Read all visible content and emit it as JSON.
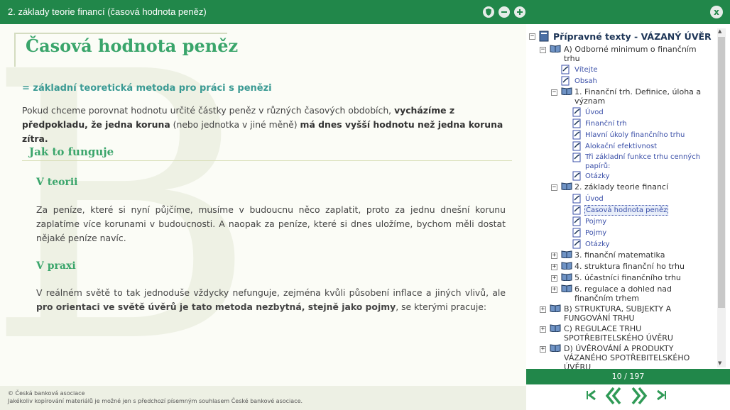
{
  "window": {
    "title": "2. základy teorie financí (časová hodnota peněz)",
    "buttons": [
      "shield-icon",
      "minus-icon",
      "plus-icon"
    ],
    "close_label": "x"
  },
  "content": {
    "watermark": "B",
    "title": "Časová hodnota peněz",
    "subtitle": "= základní teoretická metoda pro práci s penězi",
    "intro_part1": "Pokud chceme porovnat hodnotu určité částky peněz v různých časových obdobích, ",
    "intro_bold1": "vycházíme z předpokladu, že jedna koruna",
    "intro_part2": " (nebo jednotka v jiné měně) ",
    "intro_bold2": "má dnes vyšší hodnotu než jedna koruna zítra.",
    "section_heading": "Jak to funguje",
    "theory_heading": "V teorii",
    "theory_text": "Za peníze, které si nyní půjčíme, musíme v budoucnu něco zaplatit, proto za jednu dnešní korunu zaplatíme více korunami v budoucnosti. A naopak za peníze, které si dnes uložíme, bychom měli dostat nějaké peníze navíc.",
    "practice_heading": "V praxi",
    "practice_part1": "V reálném světě to tak jednoduše vždycky nefunguje, zejména kvůli působení inflace a jiných vlivů, ale ",
    "practice_bold": "pro orientaci ve světě úvěrů je tato metoda nezbytná, stejně jako pojmy",
    "practice_part2": ", se kterými pracuje:"
  },
  "footer": {
    "line1": "© Česká banková asociace",
    "line2": "Jakékoliv kopírování materiálů je možné jen s předchozí písemným souhlasem České bankové asociace."
  },
  "toc": {
    "root": "Přípravné texty - VÁZANÝ ÚVĚR",
    "a_line1": "A) Odborné minimum o finančním",
    "a_line2": "trhu",
    "vitejte": "Vítejte",
    "obsah": "Obsah",
    "ch1_line1": "1. Finanční trh. Definice, úloha a",
    "ch1_line2": "význam",
    "ch1_items": [
      "Úvod",
      "Finanční trh",
      "Hlavní úkoly finančního trhu",
      "Alokační efektivnost"
    ],
    "ch1_item5_line1": "Tři základní funkce trhu cenných",
    "ch1_item5_line2": "papírů:",
    "ch1_otazky": "Otázky",
    "ch2": "2. základy teorie financí",
    "ch2_items": [
      "Úvod",
      "Časová hodnota peněz",
      "Pojmy",
      "Pojmy",
      "Otázky"
    ],
    "ch3": "3. finanční matematika",
    "ch4": "4. struktura finanční ho trhu",
    "ch5": "5. účastníci finančního trhu",
    "ch6_line1": "6. regulace a dohled nad",
    "ch6_line2": "finančním trhem",
    "b_line1": "B) STRUKTURA, SUBJEKTY A",
    "b_line2": "FUNGOVÁNÍ TRHU",
    "c_line1": "C) REGULACE TRHU",
    "c_line2": "SPOTŘEBITELSKÉHO ÚVĚRU",
    "d_line1": "D) ÚVĚROVÁNÍ A PRODUKTY",
    "d_line2": "VÁZANÉHO SPOTŘEBITELSKÉHO",
    "d_line3": "ÚVĚRU"
  },
  "pager": {
    "text": "10 / 197"
  },
  "nav": [
    "first-page-icon",
    "previous-page-icon",
    "next-page-icon",
    "last-page-icon"
  ],
  "colors": {
    "brand_green": "#21874a",
    "heading_green": "#3aa56b",
    "teal": "#3a9a93",
    "link_blue": "#3a4fa8"
  }
}
